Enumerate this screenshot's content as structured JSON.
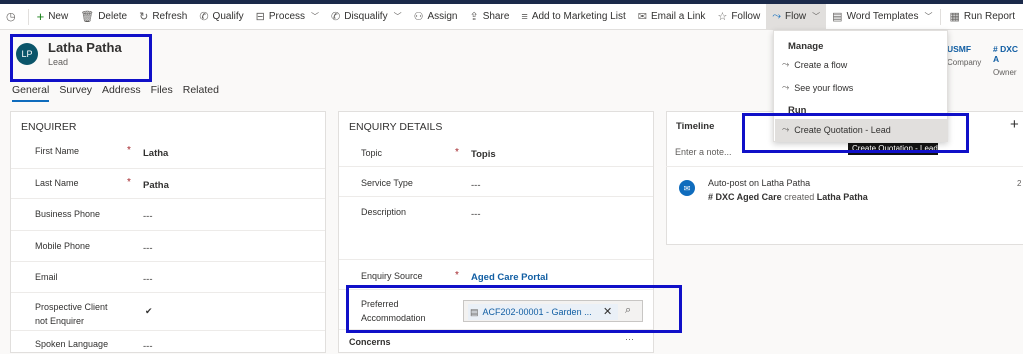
{
  "commands": [
    {
      "icon": "◷",
      "label": ""
    },
    {
      "icon": "+",
      "label": "New"
    },
    {
      "icon": "🗑",
      "label": "Delete"
    },
    {
      "icon": "↻",
      "label": "Refresh"
    },
    {
      "icon": "✆",
      "label": "Qualify"
    },
    {
      "icon": "⊟",
      "label": "Process"
    },
    {
      "icon": "✆",
      "label": "Disqualify"
    },
    {
      "icon": "⚇",
      "label": "Assign"
    },
    {
      "icon": "⇪",
      "label": "Share"
    },
    {
      "icon": "≡",
      "label": "Add to Marketing List"
    },
    {
      "icon": "✉",
      "label": "Email a Link"
    },
    {
      "icon": "☆",
      "label": "Follow"
    },
    {
      "icon": "⤳",
      "label": "Flow"
    },
    {
      "icon": "▤",
      "label": "Word Templates"
    },
    {
      "icon": "▦",
      "label": "Run Report"
    }
  ],
  "record": {
    "initials": "LP",
    "name": "Latha Patha",
    "type": "Lead"
  },
  "header_fields": [
    {
      "value": "USMF",
      "label": "Company"
    },
    {
      "value": "# DXC A",
      "label": "Owner"
    }
  ],
  "tabs": [
    "General",
    "Survey",
    "Address",
    "Files",
    "Related"
  ],
  "enquirer": {
    "title": "ENQUIRER",
    "fields": [
      {
        "label": "First Name",
        "required": "*",
        "value": "Latha"
      },
      {
        "label": "Last Name",
        "required": "*",
        "value": "Patha"
      },
      {
        "label": "Business Phone",
        "value": "---"
      },
      {
        "label": "Mobile Phone",
        "value": "---"
      },
      {
        "label": "Email",
        "value": "---"
      },
      {
        "label": "Prospective Client not Enquirer",
        "value": "✔"
      },
      {
        "label": "Spoken Language",
        "value": "---"
      }
    ]
  },
  "enquiry": {
    "title": "ENQUIRY DETAILS",
    "fields": [
      {
        "label": "Topic",
        "required": "*",
        "value": "Topis"
      },
      {
        "label": "Service Type",
        "value": "---"
      },
      {
        "label": "Description",
        "value": "---"
      },
      {
        "label": "Enquiry Source",
        "required": "*",
        "value": "Aged Care Portal"
      },
      {
        "label": "Preferred Accommodation",
        "value": "ACF202-00001 - Garden ..."
      }
    ],
    "concerns_label": "Concerns",
    "concerns_more": "···"
  },
  "timeline": {
    "title": "Timeline",
    "add": "+",
    "note_placeholder": "Enter a note...",
    "post_title": "Auto-post on Latha Patha",
    "post_owner": "# DXC Aged Care",
    "post_verb": "created",
    "post_subject": "Latha Patha",
    "post_time": "2"
  },
  "flow_menu": {
    "manage_header": "Manage",
    "items": [
      "Create a flow",
      "See your flows"
    ],
    "run_header": "Run",
    "run_items": [
      "Create Quotation - Lead"
    ],
    "tooltip": "Create Quotation - Lead"
  },
  "colors": {
    "accent": "#0f6cbd",
    "link": "#115ea3",
    "highlight": "#1010c8",
    "avatar": "#0b556a"
  }
}
